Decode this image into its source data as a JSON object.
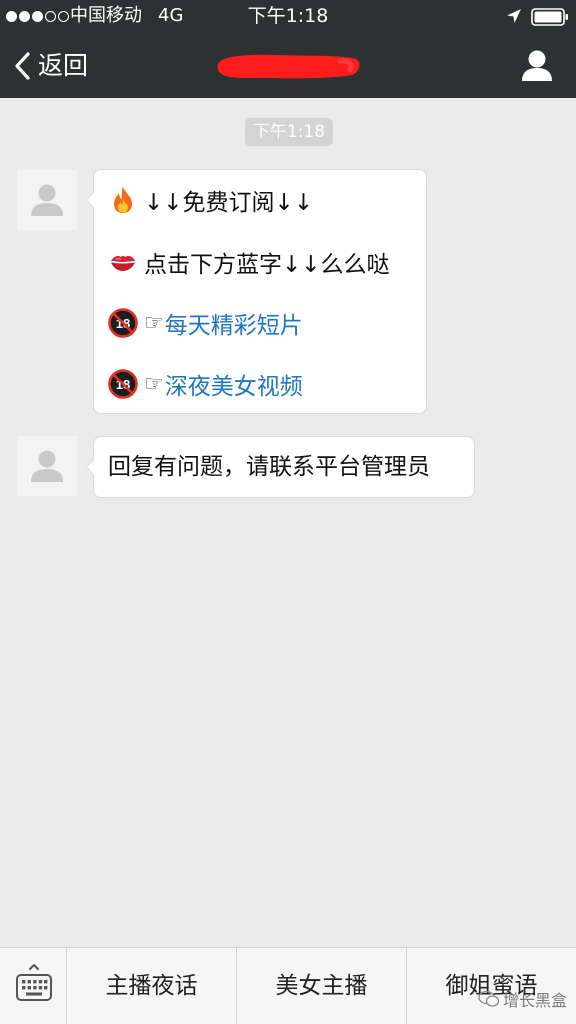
{
  "status_bar": {
    "signal_dots": [
      true,
      true,
      true,
      false,
      false
    ],
    "carrier": "中国移动",
    "network": "4G",
    "time": "下午1:18"
  },
  "nav": {
    "back_label": "返回",
    "title": "",
    "redaction_color": "#ff1c1c"
  },
  "chat": {
    "timestamp": "下午1:18",
    "messages": [
      {
        "lines": [
          {
            "emoji": "fire-icon",
            "text": "↓↓免费订阅↓↓"
          },
          {
            "emoji": "kiss-mark-icon",
            "text": "点击下方蓝字↓↓么么哒"
          },
          {
            "emoji": "no-under-18-icon",
            "pointer": "☞",
            "link": "每天精彩短片"
          },
          {
            "emoji": "no-under-18-icon",
            "pointer": "☞",
            "link": "深夜美女视频"
          }
        ]
      },
      {
        "text": "回复有问题，请联系平台管理员"
      }
    ]
  },
  "menu": {
    "items": [
      "主播夜话",
      "美女主播",
      "御姐蜜语"
    ]
  },
  "watermark": "增长黑盒",
  "colors": {
    "nav_bg": "#2e3132",
    "chat_bg": "#ebebeb",
    "link": "#1f77c4",
    "bubble_border": "#dadada"
  }
}
